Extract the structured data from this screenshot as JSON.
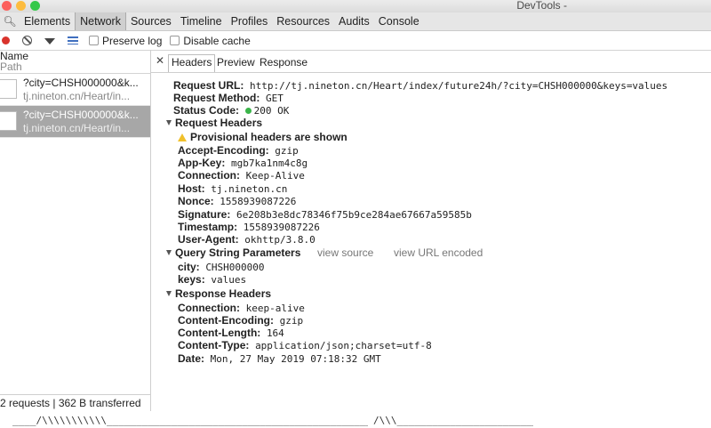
{
  "window": {
    "title": "DevTools -"
  },
  "panels": [
    "Elements",
    "Network",
    "Sources",
    "Timeline",
    "Profiles",
    "Resources",
    "Audits",
    "Console"
  ],
  "toolbar": {
    "preserve_log": "Preserve log",
    "disable_cache": "Disable cache"
  },
  "request_list": {
    "header_name": "Name",
    "header_path": "Path",
    "items": [
      {
        "name": "?city=CHSH000000&k...",
        "host": "tj.nineton.cn/Heart/in..."
      },
      {
        "name": "?city=CHSH000000&k...",
        "host": "tj.nineton.cn/Heart/in..."
      }
    ],
    "status": "2 requests | 362 B transferred"
  },
  "detail_tabs": [
    "Headers",
    "Preview",
    "Response"
  ],
  "general": [
    {
      "key": "Request URL:",
      "value": "http://tj.nineton.cn/Heart/index/future24h/?city=CHSH000000&keys=values"
    },
    {
      "key": "Request Method:",
      "value": "GET"
    },
    {
      "key": "Status Code:",
      "value": "200 OK"
    }
  ],
  "request_headers": {
    "title": "Request Headers",
    "warning": "Provisional headers are shown",
    "items": [
      {
        "key": "Accept-Encoding:",
        "value": "gzip"
      },
      {
        "key": "App-Key:",
        "value": "mgb7ka1nm4c8g"
      },
      {
        "key": "Connection:",
        "value": "Keep-Alive"
      },
      {
        "key": "Host:",
        "value": "tj.nineton.cn"
      },
      {
        "key": "Nonce:",
        "value": "1558939087226"
      },
      {
        "key": "Signature:",
        "value": "6e208b3e8dc78346f75b9ce284ae67667a59585b"
      },
      {
        "key": "Timestamp:",
        "value": "1558939087226"
      },
      {
        "key": "User-Agent:",
        "value": "okhttp/3.8.0"
      }
    ]
  },
  "query_params": {
    "title": "Query String Parameters",
    "view_source": "view source",
    "view_url_encoded": "view URL encoded",
    "items": [
      {
        "key": "city:",
        "value": "CHSH000000"
      },
      {
        "key": "keys:",
        "value": "values"
      }
    ]
  },
  "response_headers": {
    "title": "Response Headers",
    "items": [
      {
        "key": "Connection:",
        "value": "keep-alive"
      },
      {
        "key": "Content-Encoding:",
        "value": "gzip"
      },
      {
        "key": "Content-Length:",
        "value": "164"
      },
      {
        "key": "Content-Type:",
        "value": "application/json;charset=utf-8"
      },
      {
        "key": "Date:",
        "value": "Mon, 27 May 2019 07:18:32 GMT"
      }
    ]
  },
  "decorations": {
    "d1": "____/\\\\\\\\\\\\\\\\\\\\\\______________________________________________________",
    "d2": "/\\\\\\_____________________________"
  }
}
